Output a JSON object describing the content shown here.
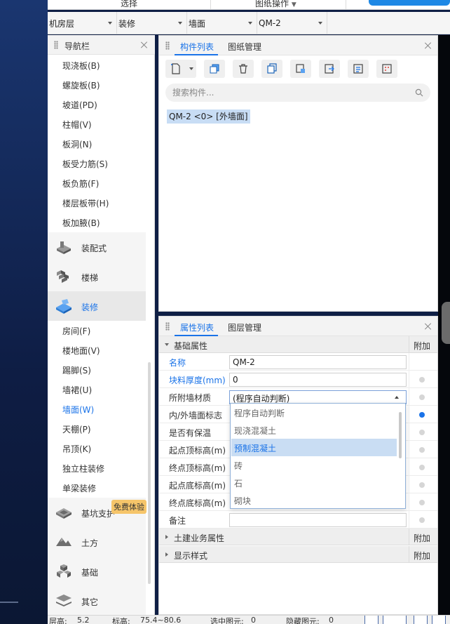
{
  "top_menu": {
    "items": [
      "选择",
      "图纸操作"
    ],
    "action_label": ""
  },
  "filter_bar": {
    "floor": "机房层",
    "category": "装修",
    "subtype": "墙面",
    "component": "QM-2"
  },
  "nav_panel": {
    "title": "导航栏",
    "sub_items_top": [
      "现浇板(B)",
      "螺旋板(B)",
      "坡道(PD)",
      "柱帽(V)",
      "板洞(N)",
      "板受力筋(S)",
      "板负筋(F)",
      "楼层板带(H)",
      "板加腋(B)"
    ],
    "categories_top": [
      "装配式",
      "楼梯",
      "装修"
    ],
    "sub_items_decor": [
      "房间(F)",
      "楼地面(V)",
      "踢脚(S)",
      "墙裙(U)",
      "墙面(W)",
      "天棚(P)",
      "吊顶(K)",
      "独立柱装修",
      "单梁装修"
    ],
    "active_item": "墙面(W)",
    "categories_bottom": [
      "基坑支护",
      "土方",
      "基础",
      "其它"
    ],
    "trial_badge": "免费体验"
  },
  "component_panel": {
    "tabs": [
      "构件列表",
      "图纸管理"
    ],
    "active_tab": "构件列表",
    "search_placeholder": "搜索构件...",
    "items": [
      "QM-2 <0> [外墙面]"
    ]
  },
  "property_panel": {
    "tabs": [
      "属性列表",
      "图层管理"
    ],
    "active_tab": "属性列表",
    "section_basic": "基础属性",
    "add_column": "附加",
    "rows": [
      {
        "name": "名称",
        "value": "QM-2"
      },
      {
        "name": "块料厚度(mm)",
        "value": "0"
      },
      {
        "name": "所附墙材质",
        "value": "(程序自动判断)"
      },
      {
        "name": "内/外墙面标志",
        "value": ""
      },
      {
        "name": "是否有保温",
        "value": ""
      },
      {
        "name": "起点顶标高(m)",
        "value": ""
      },
      {
        "name": "终点顶标高(m)",
        "value": ""
      },
      {
        "name": "起点底标高(m)",
        "value": ""
      },
      {
        "name": "终点底标高(m)",
        "value": ""
      },
      {
        "name": "备注",
        "value": ""
      }
    ],
    "section_civil": "土建业务属性",
    "section_display": "显示样式"
  },
  "material_dropdown": {
    "options": [
      "程序自动判断",
      "现浇混凝土",
      "预制混凝土",
      "砖",
      "石",
      "砌块"
    ],
    "highlighted": "预制混凝土"
  },
  "status_bar": {
    "floor_height_label": "层高:",
    "floor_height": "5.2",
    "elevation_label": "标高:",
    "elevation": "75.4~80.6",
    "selected_label": "选中图元:",
    "selected_count": "0",
    "hidden_label": "隐藏图元:",
    "hidden_count": "0"
  },
  "colors": {
    "accent": "#1a73e8",
    "selection": "#c8ddf5",
    "badge": "#f6c56a"
  }
}
